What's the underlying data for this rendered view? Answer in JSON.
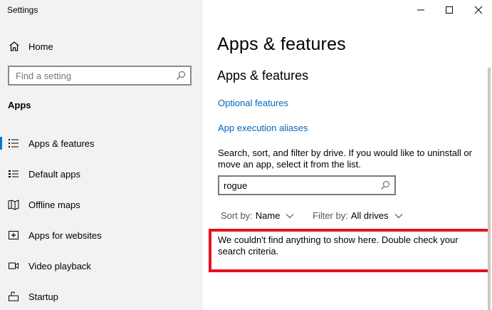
{
  "window": {
    "title": "Settings"
  },
  "sidebar": {
    "home_label": "Home",
    "search_placeholder": "Find a setting",
    "section_title": "Apps",
    "items": [
      {
        "label": "Apps & features",
        "icon": "list-icon",
        "active": true
      },
      {
        "label": "Default apps",
        "icon": "default-apps-icon",
        "active": false
      },
      {
        "label": "Offline maps",
        "icon": "map-icon",
        "active": false
      },
      {
        "label": "Apps for websites",
        "icon": "open-in-icon",
        "active": false
      },
      {
        "label": "Video playback",
        "icon": "video-icon",
        "active": false
      },
      {
        "label": "Startup",
        "icon": "startup-icon",
        "active": false
      }
    ]
  },
  "main": {
    "page_title": "Apps & features",
    "section_title": "Apps & features",
    "links": {
      "optional_features": "Optional features",
      "execution_aliases": "App execution aliases"
    },
    "description": "Search, sort, and filter by drive. If you would like to uninstall or move an app, select it from the list.",
    "search_value": "rogue",
    "sort": {
      "label": "Sort by:",
      "value": "Name"
    },
    "filter": {
      "label": "Filter by:",
      "value": "All drives"
    },
    "empty_message": "We couldn't find anything to show here. Double check your search criteria."
  },
  "colors": {
    "accent": "#0078d4",
    "link": "#0067c0",
    "highlight_box": "#e3121e",
    "sidebar_bg": "#f2f2f2"
  }
}
